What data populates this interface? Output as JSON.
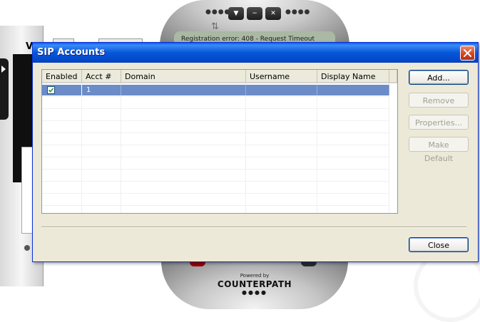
{
  "background_app": {
    "left_tab_letter": "V",
    "lcd_text": "Registration error: 408 - Request Timeout",
    "powered_by": "Powered by",
    "brand": "COUNTERPATH"
  },
  "dialog": {
    "title": "SIP Accounts",
    "list": {
      "columns": [
        "Enabled",
        "Acct #",
        "Domain",
        "Username",
        "Display Name"
      ],
      "rows": [
        {
          "enabled": true,
          "acct": "1",
          "domain": "",
          "username": "",
          "display_name": ""
        }
      ]
    },
    "buttons": {
      "add": "Add...",
      "remove": "Remove",
      "properties": "Properties...",
      "make_default": "Make Default",
      "close": "Close"
    }
  },
  "colors": {
    "title_bar": "#0757d9",
    "selection": "#6b8cc7",
    "dialog_bg": "#ece9d8",
    "close_button": "#d6401b"
  }
}
